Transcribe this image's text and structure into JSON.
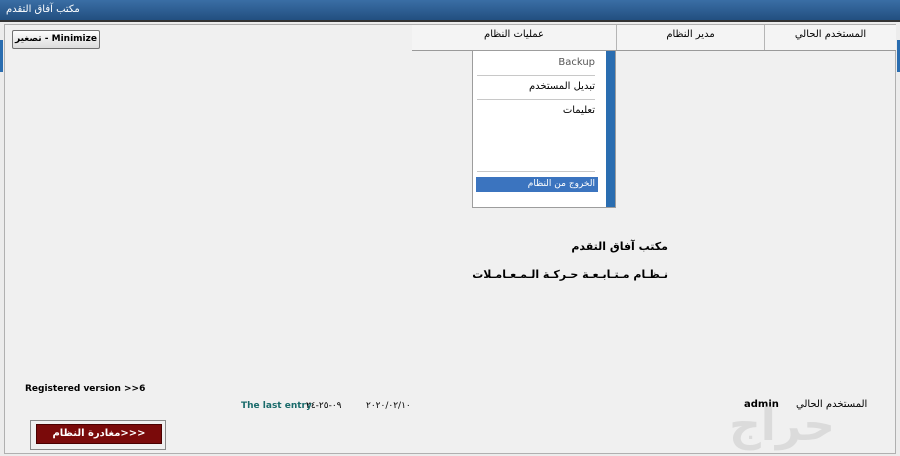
{
  "window": {
    "title": "مكتب آفاق التقدم"
  },
  "toolbar": {
    "minimize_label": "تصغير - Minimize"
  },
  "menubar": {
    "items": [
      {
        "label": "المستخدم الحالي"
      },
      {
        "label": "مدير النظام"
      },
      {
        "label": "عمليات النظام"
      }
    ]
  },
  "dropdown": {
    "items": [
      {
        "label": "Backup"
      },
      {
        "label": "تبديل المستخدم"
      },
      {
        "label": "تعليمات"
      },
      {
        "label": "الخروج من النظام"
      }
    ]
  },
  "main": {
    "heading": "مكتب آفاق التقدم",
    "subheading": "نـظـام مـتـابـعـة حـركـة الـمـعـامـلات"
  },
  "footer": {
    "registered_version": "Registered version  >>6",
    "last_entry_label": "The last entry",
    "last_entry_date_1": "٢٠٢٠/٠٢/١٠",
    "last_entry_date_2": "٠٩-٢٥-٢٤",
    "current_user_label": "المستخدم الحالي",
    "current_user_value": "admin",
    "exit_button_label": "مغادرة النظام>>>"
  },
  "watermark": {
    "text": "حراج"
  },
  "colors": {
    "accent": "#2a6db0",
    "exit_button": "#7a0a0a",
    "menu_highlight": "#3b74bf"
  }
}
